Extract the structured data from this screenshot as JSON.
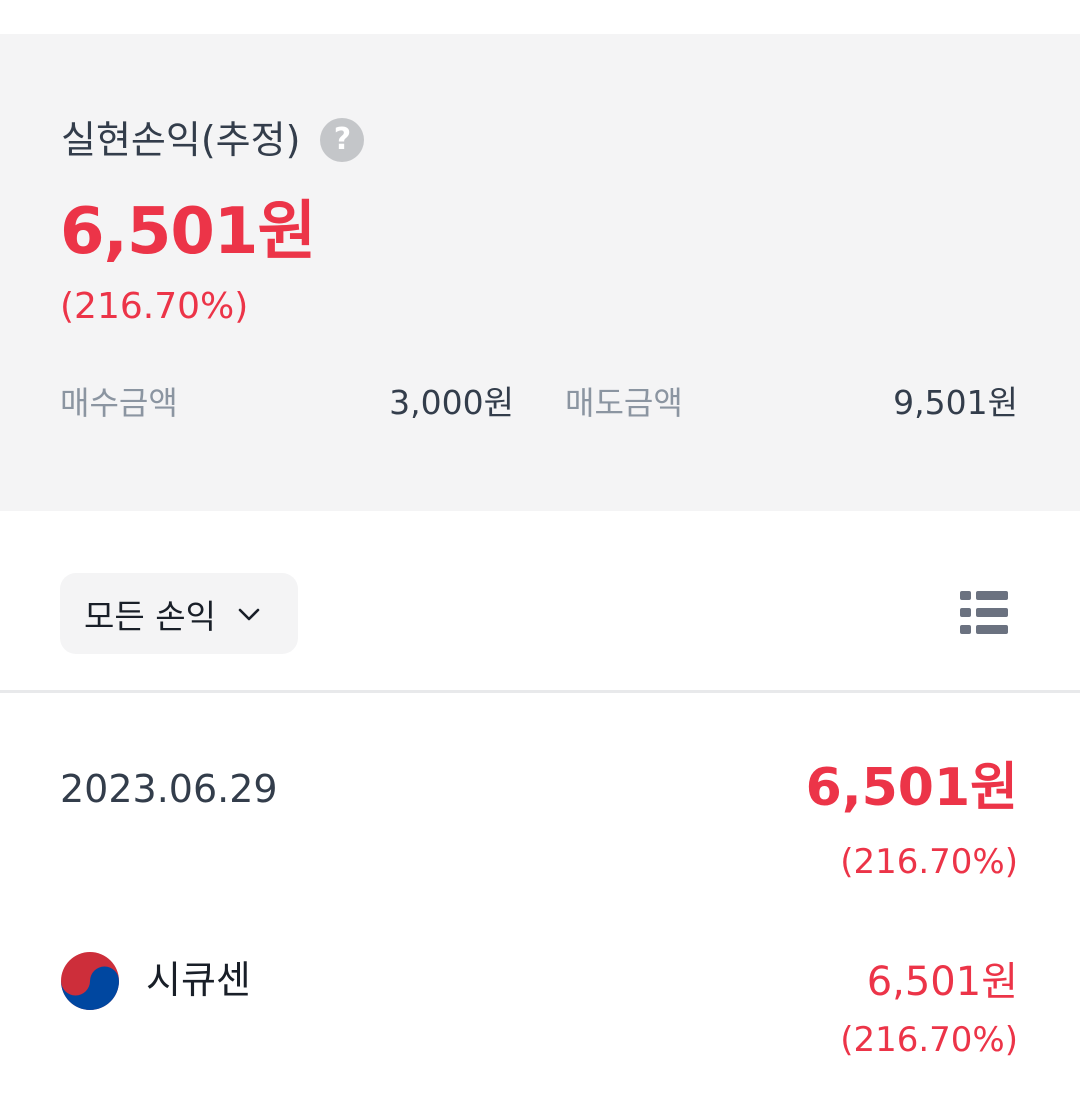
{
  "summary": {
    "title": "실현손익(추정)",
    "help_icon": "question-mark-icon",
    "amount": "6,501원",
    "rate": "(216.70%)",
    "buy_label": "매수금액",
    "buy_value": "3,000원",
    "sell_label": "매도금액",
    "sell_value": "9,501원"
  },
  "filter": {
    "label": "모든 손익",
    "icon": "chevron-down-icon"
  },
  "view_toggle_icon": "list-view-icon",
  "day": {
    "date": "2023.06.29",
    "amount": "6,501원",
    "rate": "(216.70%)"
  },
  "stock": {
    "flag_icon": "korea-flag-icon",
    "name": "시큐센",
    "amount": "6,501원",
    "rate": "(216.70%)"
  },
  "colors": {
    "accent_red": "#ec3448",
    "summary_bg": "#f4f4f5",
    "text_primary": "#333d4b",
    "text_secondary": "#8b95a1"
  }
}
